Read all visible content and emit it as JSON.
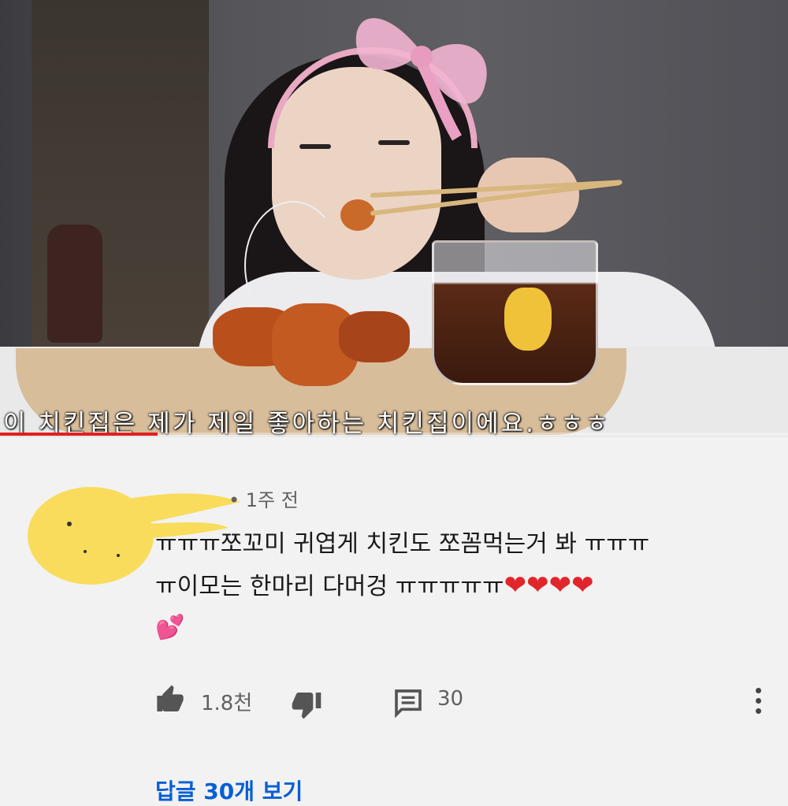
{
  "video": {
    "subtitle": "이 치킨집은 제가 제일 좋아하는 치킨집이에요.ㅎㅎㅎ",
    "progress_fraction": 0.2
  },
  "comment": {
    "author_redacted": true,
    "timestamp": "• 1주 전",
    "text_lines": [
      "ㅠㅠㅠ쪼꼬미 귀엽게 치킨도 쪼꼼먹는거 봐   ㅠㅠㅠ",
      "ㅠ이모는 한마리 다머겅 ㅠㅠㅠㅠㅠ"
    ],
    "heart_emoji": "❤❤❤❤",
    "sparkle_emoji": "💕",
    "like_count": "1.8천",
    "reply_count": "30",
    "view_replies": "답글 30개 보기",
    "icons": {
      "like": "thumbs-up-icon",
      "dislike": "thumbs-down-icon",
      "reply": "comment-icon",
      "more": "more-vertical-icon"
    },
    "accent_color": "#065fd4"
  }
}
